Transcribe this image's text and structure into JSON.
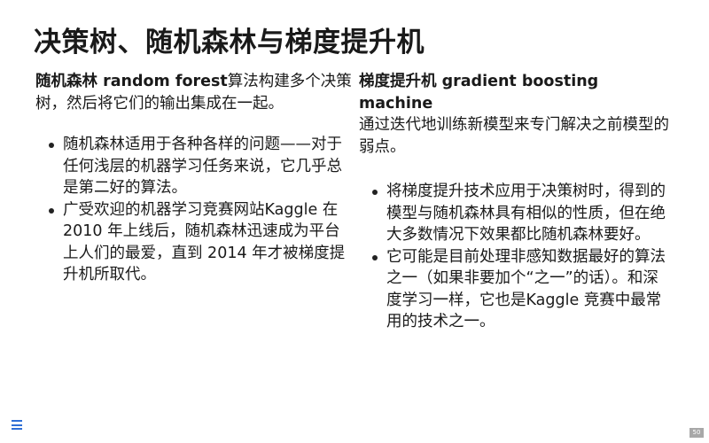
{
  "slide": {
    "title": "决策树、随机森林与梯度提升机",
    "page_number": "50"
  },
  "left": {
    "intro_term": "随机森林 random forest",
    "intro_text": "算法构建多个决策树，然后将它们的输出集成在一起。",
    "bullets": [
      "随机森林适用于各种各样的问题——对于任何浅层的机器学习任务来说，它几乎总是第二好的算法。",
      "广受欢迎的机器学习竞赛网站Kaggle 在 2010 年上线后，随机森林迅速成为平台上人们的最爱，直到 2014 年才被梯度提升机所取代。"
    ]
  },
  "right": {
    "intro_term": "梯度提升机 gradient boosting machine",
    "intro_text": "通过迭代地训练新模型来专门解决之前模型的弱点。",
    "bullets": [
      "将梯度提升技术应用于决策树时，得到的模型与随机森林具有相似的性质，但在绝大多数情况下效果都比随机森林要好。",
      "它可能是目前处理非感知数据最好的算法之一（如果非要加个“之一”的话）。和深度学习一样，它也是Kaggle 竞赛中最常用的技术之一。"
    ]
  },
  "icons": {
    "menu": "hamburger-menu-icon"
  }
}
